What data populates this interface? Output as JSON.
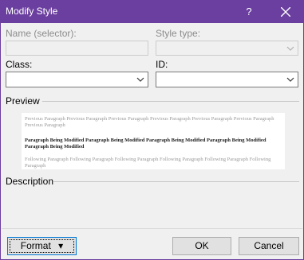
{
  "window": {
    "title": "Modify Style",
    "help": "?"
  },
  "fields": {
    "name_label": "Name (selector):",
    "style_type_label": "Style type:",
    "class_label": "Class:",
    "id_label": "ID:"
  },
  "sections": {
    "preview_label": "Preview",
    "description_label": "Description"
  },
  "preview": {
    "previous": "Previous Paragraph Previous Paragraph Previous Paragraph Previous Paragraph Previous Paragraph Previous Paragraph Previous Paragraph",
    "current": "Paragraph Being Modified Paragraph Being Modified Paragraph Being Modified Paragraph Being Modified Paragraph Being Modified",
    "following": "Following Paragraph Following Paragraph Following Paragraph Following Paragraph Following Paragraph Following Paragraph"
  },
  "buttons": {
    "format": "Format",
    "format_arrow": "▾",
    "ok": "OK",
    "cancel": "Cancel"
  },
  "icons": {
    "close": "close-icon",
    "dropdown": "chevron-down-icon"
  }
}
